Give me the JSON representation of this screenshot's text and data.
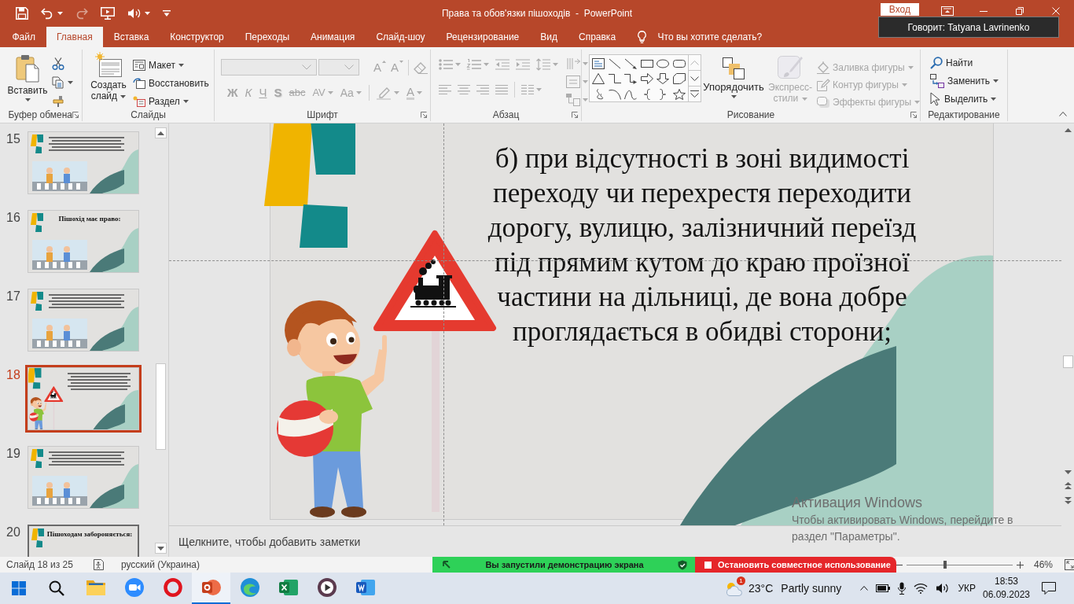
{
  "window": {
    "title": "Права та обов'язки пішоходів  -  PowerPoint",
    "sign_in": "Вход",
    "tooltip": "Говорит: Tatyana Lavrinenko"
  },
  "quick_access": {
    "redo": {
      "disabled": true
    }
  },
  "tabs": [
    {
      "label": "Файл",
      "selected": false
    },
    {
      "label": "Главная",
      "selected": true
    },
    {
      "label": "Вставка",
      "selected": false
    },
    {
      "label": "Конструктор",
      "selected": false
    },
    {
      "label": "Переходы",
      "selected": false
    },
    {
      "label": "Анимация",
      "selected": false
    },
    {
      "label": "Слайд-шоу",
      "selected": false
    },
    {
      "label": "Рецензирование",
      "selected": false
    },
    {
      "label": "Вид",
      "selected": false
    },
    {
      "label": "Справка",
      "selected": false
    }
  ],
  "tell_me": "Что вы хотите сделать?",
  "ribbon": {
    "clipboard": {
      "label": "Буфер обмена",
      "paste": "Вставить"
    },
    "slides": {
      "label": "Слайды",
      "new_slide": "Создать слайд",
      "items": [
        {
          "kind": "layout",
          "label": "Макет",
          "dropdown": true
        },
        {
          "kind": "reset",
          "label": "Восстановить",
          "dropdown": false
        },
        {
          "kind": "section",
          "label": "Раздел",
          "dropdown": true
        }
      ]
    },
    "font": {
      "label": "Шрифт",
      "disabled": true,
      "size_buttons": [
        {
          "kind": "grow",
          "label": "A"
        },
        {
          "kind": "shrink",
          "label": "A"
        }
      ],
      "style_buttons": [
        {
          "kind": "bold",
          "label": "Ж",
          "dropdown": false
        },
        {
          "kind": "italic",
          "label": "К",
          "dropdown": false
        },
        {
          "kind": "underline",
          "label": "Ч",
          "dropdown": false
        },
        {
          "kind": "shadow",
          "label": "S",
          "dropdown": false
        },
        {
          "kind": "strikethrough",
          "label": "abc",
          "dropdown": false
        },
        {
          "kind": "spacing",
          "label": "AV",
          "dropdown": true
        },
        {
          "kind": "case",
          "label": "Aa",
          "dropdown": true
        }
      ],
      "font_color": "A"
    },
    "paragraph": {
      "label": "Абзац",
      "disabled": true
    },
    "drawing": {
      "label": "Рисование",
      "arrange": "Упорядочить",
      "quick_styles": {
        "label": "Экспресс-стили",
        "disabled": true
      },
      "shape_format": [
        {
          "kind": "fill",
          "label": "Заливка фигуры",
          "disabled": true
        },
        {
          "kind": "outline",
          "label": "Контур фигуры",
          "disabled": true
        },
        {
          "kind": "effects",
          "label": "Эффекты фигуры",
          "disabled": true
        }
      ]
    },
    "editing": {
      "label": "Редактирование",
      "items": [
        {
          "kind": "find",
          "label": "Найти",
          "dropdown": false
        },
        {
          "kind": "replace",
          "label": "Заменить",
          "dropdown": true
        },
        {
          "kind": "select",
          "label": "Выделить",
          "dropdown": true
        }
      ]
    }
  },
  "thumbnails": [
    {
      "number": "15",
      "selected": false,
      "hovered": false,
      "kind": "text"
    },
    {
      "number": "16",
      "selected": false,
      "hovered": false,
      "kind": "title",
      "title": "Пішохід має право:"
    },
    {
      "number": "17",
      "selected": false,
      "hovered": false,
      "kind": "text"
    },
    {
      "number": "18",
      "selected": true,
      "hovered": false,
      "kind": "current"
    },
    {
      "number": "19",
      "selected": false,
      "hovered": false,
      "kind": "text"
    },
    {
      "number": "20",
      "selected": false,
      "hovered": true,
      "kind": "heading",
      "title": "Пішоходам забороняється:"
    }
  ],
  "slide": {
    "text": "б) при відсутності в зоні видимості переходу чи перехрестя переходити дорогу, вулицю, залізничний переїзд під прямим кутом до краю проїзної частини на дільниці, де вона добре проглядається в обидві сторони;"
  },
  "notes": {
    "placeholder": "Щелкните, чтобы добавить заметки"
  },
  "status_bar": {
    "slide_info": "Слайд 18 из 25",
    "language": "русский (Украина)",
    "zoom": {
      "level": 0.36,
      "reading": "46%"
    }
  },
  "share_bar": {
    "message": "Вы запустили демонстрацию экрана",
    "stop": "Остановить совместное использование"
  },
  "activation": {
    "title": "Активация Windows",
    "text": "Чтобы активировать Windows, перейдите в раздел \"Параметры\"."
  },
  "taskbar": {
    "apps": [
      {
        "kind": "files",
        "active": false
      },
      {
        "kind": "meeting",
        "active": false
      },
      {
        "kind": "browser",
        "active": false
      },
      {
        "kind": "slides",
        "active": true
      },
      {
        "kind": "web",
        "active": false
      },
      {
        "kind": "sheets",
        "active": false
      },
      {
        "kind": "media",
        "active": false
      },
      {
        "kind": "docs",
        "active": false
      }
    ],
    "tray": {
      "weather_badge": "1",
      "temperature": "23°C",
      "weather": "Partly sunny",
      "language": "УКР",
      "time": "18:53",
      "date": "06.09.2023"
    }
  }
}
